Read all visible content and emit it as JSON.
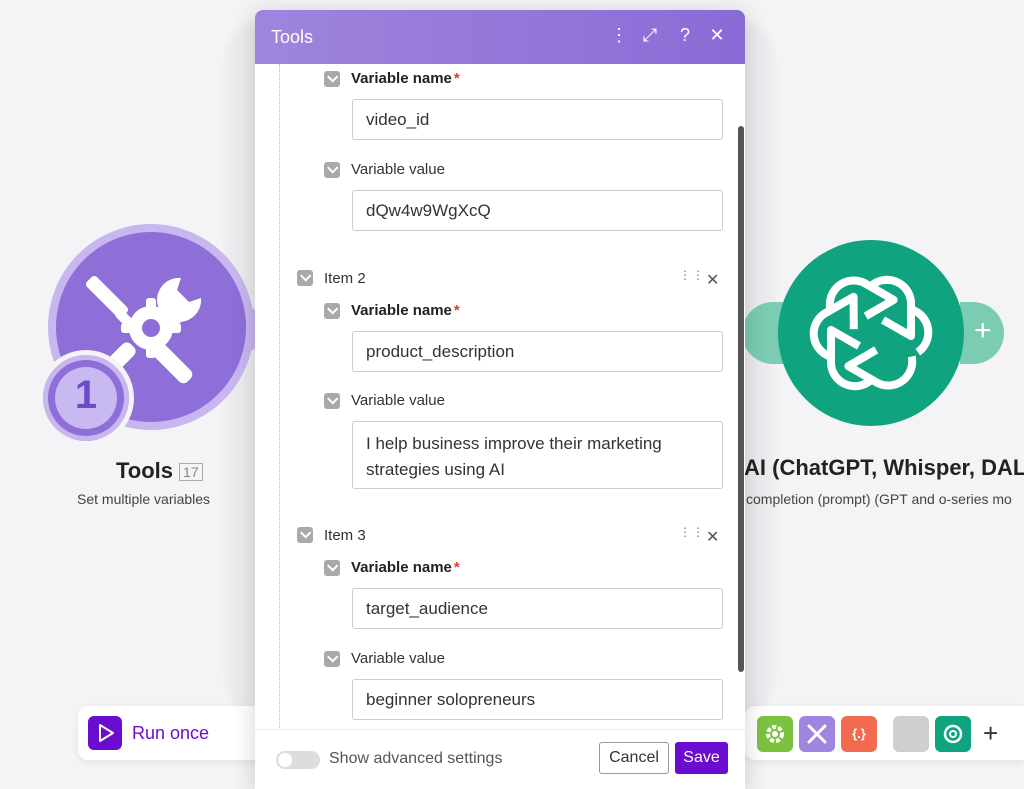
{
  "canvas": {
    "tools_node": {
      "title": "Tools",
      "badge": "17",
      "subtitle": "Set multiple variables",
      "clock_number": "1"
    },
    "openai_node": {
      "title": "AI (ChatGPT, Whisper, DALL",
      "subtitle": "completion (prompt) (GPT and o-series mo",
      "plus": "+"
    }
  },
  "modal": {
    "title": "Tools",
    "header_icons": [
      "more-vertical-icon",
      "expand-icon",
      "help-icon",
      "close-icon"
    ],
    "header_glyphs": {
      "more": "⋮",
      "expand": "⤢",
      "help": "?",
      "close": "✕"
    },
    "items": [
      {
        "name_label": "Variable name",
        "name_value": "video_id",
        "value_label": "Variable value",
        "value_value": "dQw4w9WgXcQ"
      },
      {
        "label": "Item 2",
        "name_label": "Variable name",
        "name_value": "product_description",
        "value_label": "Variable value",
        "value_value": "I help business improve their marketing strategies using AI"
      },
      {
        "label": "Item 3",
        "name_label": "Variable name",
        "name_value": "target_audience",
        "value_label": "Variable value",
        "value_value": "beginner solopreneurs"
      }
    ],
    "required_mark": "*",
    "footer": {
      "advanced_label": "Show advanced settings",
      "advanced_enabled": false,
      "cancel_label": "Cancel",
      "save_label": "Save"
    }
  },
  "toolbar": {
    "run_label": "Run once",
    "right_icons": [
      "settings-icon",
      "tools-icon",
      "json-icon",
      "blank-icon",
      "openai-icon"
    ],
    "json_glyph": "{.}",
    "add_glyph": "+"
  },
  "colors": {
    "accent": "#6a0dd1",
    "tools_purple": "#8e6fd8",
    "openai_green": "#10a37f",
    "required": "#e53935"
  }
}
